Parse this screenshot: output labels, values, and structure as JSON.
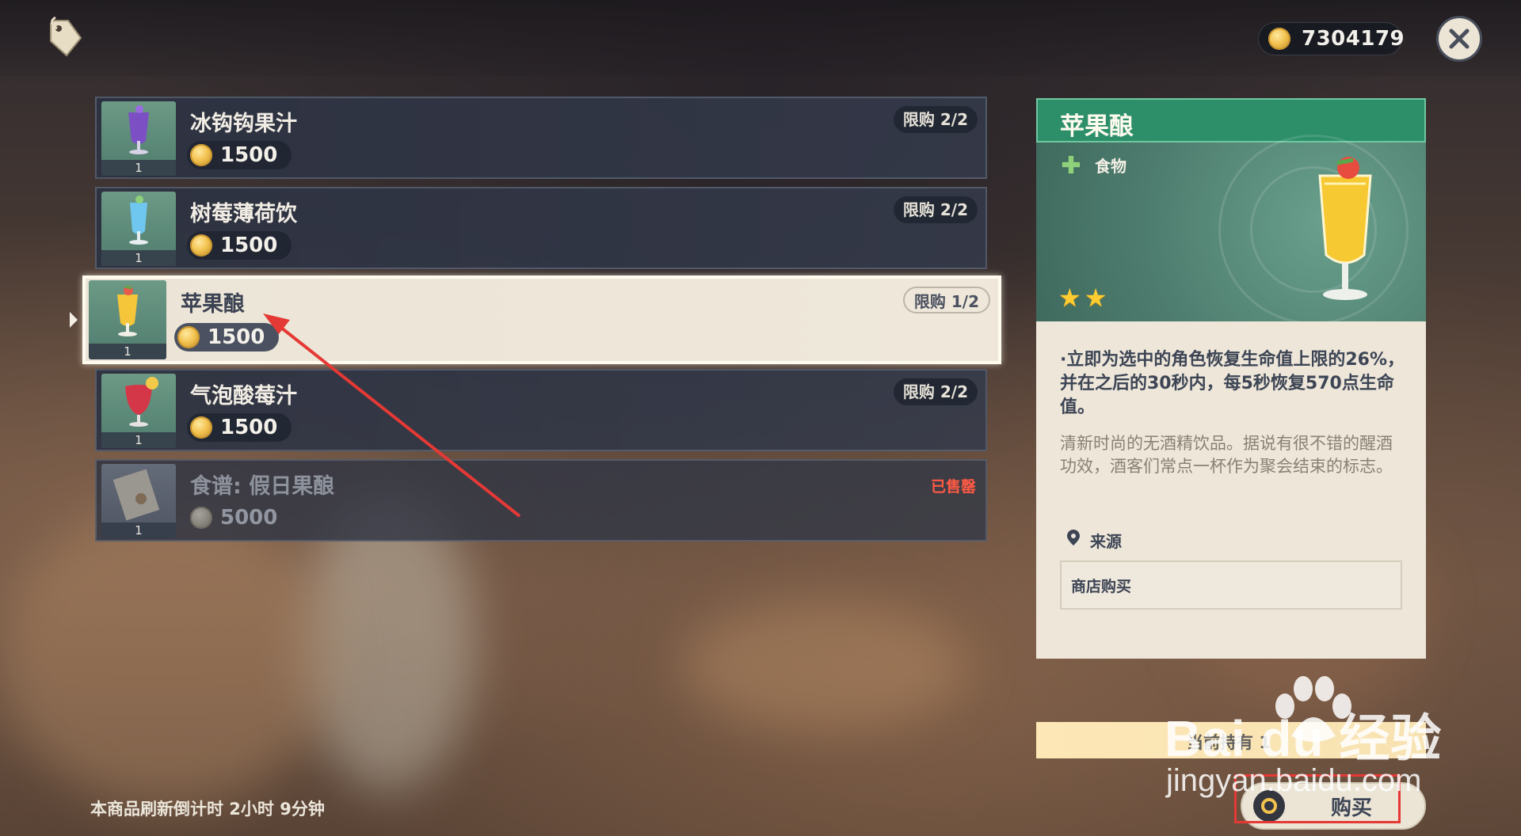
{
  "header": {
    "shop_icon": "price-tag-icon",
    "currency_icon": "mora-coin-icon",
    "currency_amount": "7304179",
    "close_icon": "close-x-icon"
  },
  "items": [
    {
      "name": "冰钩钩果汁",
      "price": "1500",
      "limit": "限购 2/2",
      "qty": "1",
      "icon": "purple-drink-icon",
      "state": "normal"
    },
    {
      "name": "树莓薄荷饮",
      "price": "1500",
      "limit": "限购 2/2",
      "qty": "1",
      "icon": "blue-drink-icon",
      "state": "normal"
    },
    {
      "name": "苹果酿",
      "price": "1500",
      "limit": "限购 1/2",
      "qty": "1",
      "icon": "yellow-drink-icon",
      "state": "selected"
    },
    {
      "name": "气泡酸莓汁",
      "price": "1500",
      "limit": "限购 2/2",
      "qty": "1",
      "icon": "red-drink-icon",
      "state": "normal"
    },
    {
      "name": "食谱: 假日果酿",
      "price": "5000",
      "sold_label": "已售罄",
      "qty": "1",
      "icon": "recipe-scroll-icon",
      "state": "soldout"
    }
  ],
  "detail": {
    "title": "苹果酿",
    "category": "食物",
    "category_icon": "food-cross-icon",
    "rarity": 2,
    "effect": "·立即为选中的角色恢复生命值上限的26%，并在之后的30秒内，每5秒恢复570点生命值。",
    "flavor": "清新时尚的无酒精饮品。据说有很不错的醒酒功效，酒客们常点一杯作为聚会结束的标志。",
    "source_label": "来源",
    "source_value": "商店购买"
  },
  "footer": {
    "owned_text": "当前持有 1",
    "buy_label": "购买",
    "refresh_text": "本商品刷新倒计时 2小时 9分钟"
  },
  "watermark": {
    "main": "Bai du 经验",
    "sub": "jingyan.baidu.com"
  },
  "colors": {
    "accent_green": "#2d8f6a",
    "star_gold": "#ffcc32",
    "sold_out_red": "#ff5a44",
    "annotation_red": "#e53935"
  }
}
